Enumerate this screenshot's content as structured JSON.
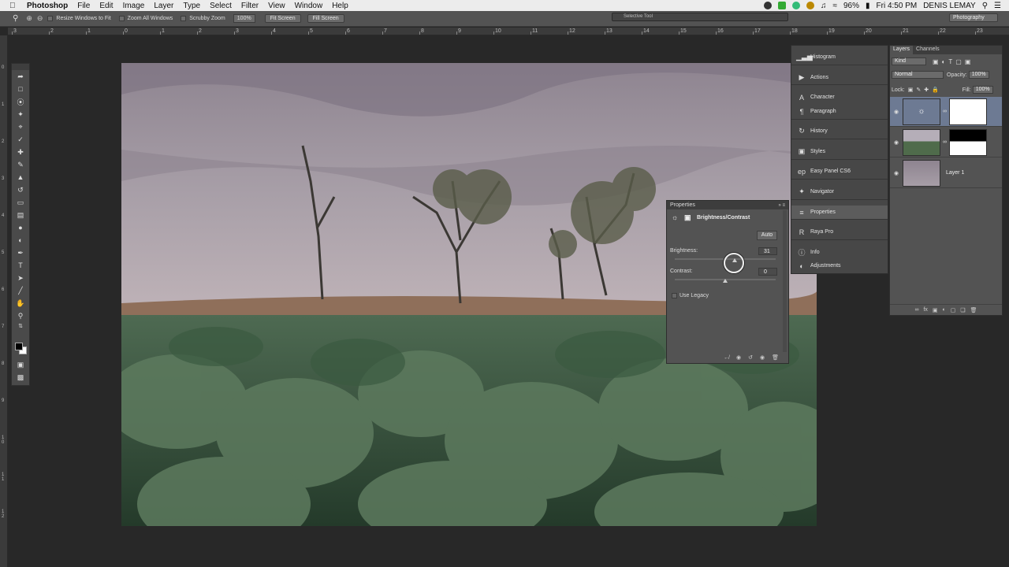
{
  "menubar": {
    "app": "Photoshop",
    "items": [
      "File",
      "Edit",
      "Image",
      "Layer",
      "Type",
      "Select",
      "Filter",
      "View",
      "Window",
      "Help"
    ],
    "battery": "96%",
    "clock": "Fri 4:50 PM",
    "user": "DENIS LEMAY"
  },
  "options_bar": {
    "resize_windows": "Resize Windows to Fit",
    "zoom_all": "Zoom All Windows",
    "scrubby": "Scrubby Zoom",
    "zoom_value": "100%",
    "fit_screen": "Fit Screen",
    "fill_screen": "Fill Screen",
    "floating_title": "Selective Tool",
    "workspace": "Photography"
  },
  "rulers": {
    "top": [
      "3",
      "2",
      "1",
      "0",
      "1",
      "2",
      "3",
      "4",
      "5",
      "6",
      "7",
      "8",
      "9",
      "10",
      "11",
      "12",
      "13",
      "14",
      "15",
      "16",
      "17",
      "18",
      "19",
      "20",
      "21",
      "22",
      "23"
    ],
    "left": [
      "0",
      "1",
      "2",
      "3",
      "4",
      "5",
      "6",
      "7",
      "8",
      "9",
      "1 0",
      "1 1",
      "1 2"
    ]
  },
  "dock": {
    "items": [
      {
        "label": "Histogram",
        "icon": "histogram-icon"
      },
      {
        "label": "Actions",
        "icon": "play-icon"
      },
      {
        "label": "Character",
        "icon": "character-icon"
      },
      {
        "label": "Paragraph",
        "icon": "paragraph-icon"
      },
      {
        "label": "History",
        "icon": "history-icon"
      },
      {
        "label": "Styles",
        "icon": "styles-icon"
      },
      {
        "label": "Easy Panel CS6",
        "icon": "ep-icon"
      },
      {
        "label": "Navigator",
        "icon": "navigator-icon"
      },
      {
        "label": "Properties",
        "icon": "properties-icon"
      },
      {
        "label": "Raya Pro",
        "icon": "raya-icon"
      },
      {
        "label": "Info",
        "icon": "info-icon"
      },
      {
        "label": "Adjustments",
        "icon": "adjustments-icon"
      }
    ]
  },
  "properties": {
    "title": "Properties",
    "adjustment": "Brightness/Contrast",
    "auto": "Auto",
    "brightness_label": "Brightness:",
    "brightness_value": "31",
    "contrast_label": "Contrast:",
    "contrast_value": "0",
    "legacy_label": "Use Legacy"
  },
  "layers": {
    "tabs": [
      "Layers",
      "Channels"
    ],
    "filter_kind": "Kind",
    "blend_mode": "Normal",
    "opacity_label": "Opacity:",
    "opacity_value": "100%",
    "lock_label": "Lock:",
    "fill_label": "Fill:",
    "fill_value": "100%",
    "rows": [
      {
        "name": "",
        "type": "adjustment"
      },
      {
        "name": "",
        "type": "masked-image"
      },
      {
        "name": "Layer 1",
        "type": "image"
      }
    ]
  },
  "colors": {
    "accent_selected_layer": "#6d7a93",
    "panel_bg": "#535353",
    "app_bg": "#282828"
  }
}
